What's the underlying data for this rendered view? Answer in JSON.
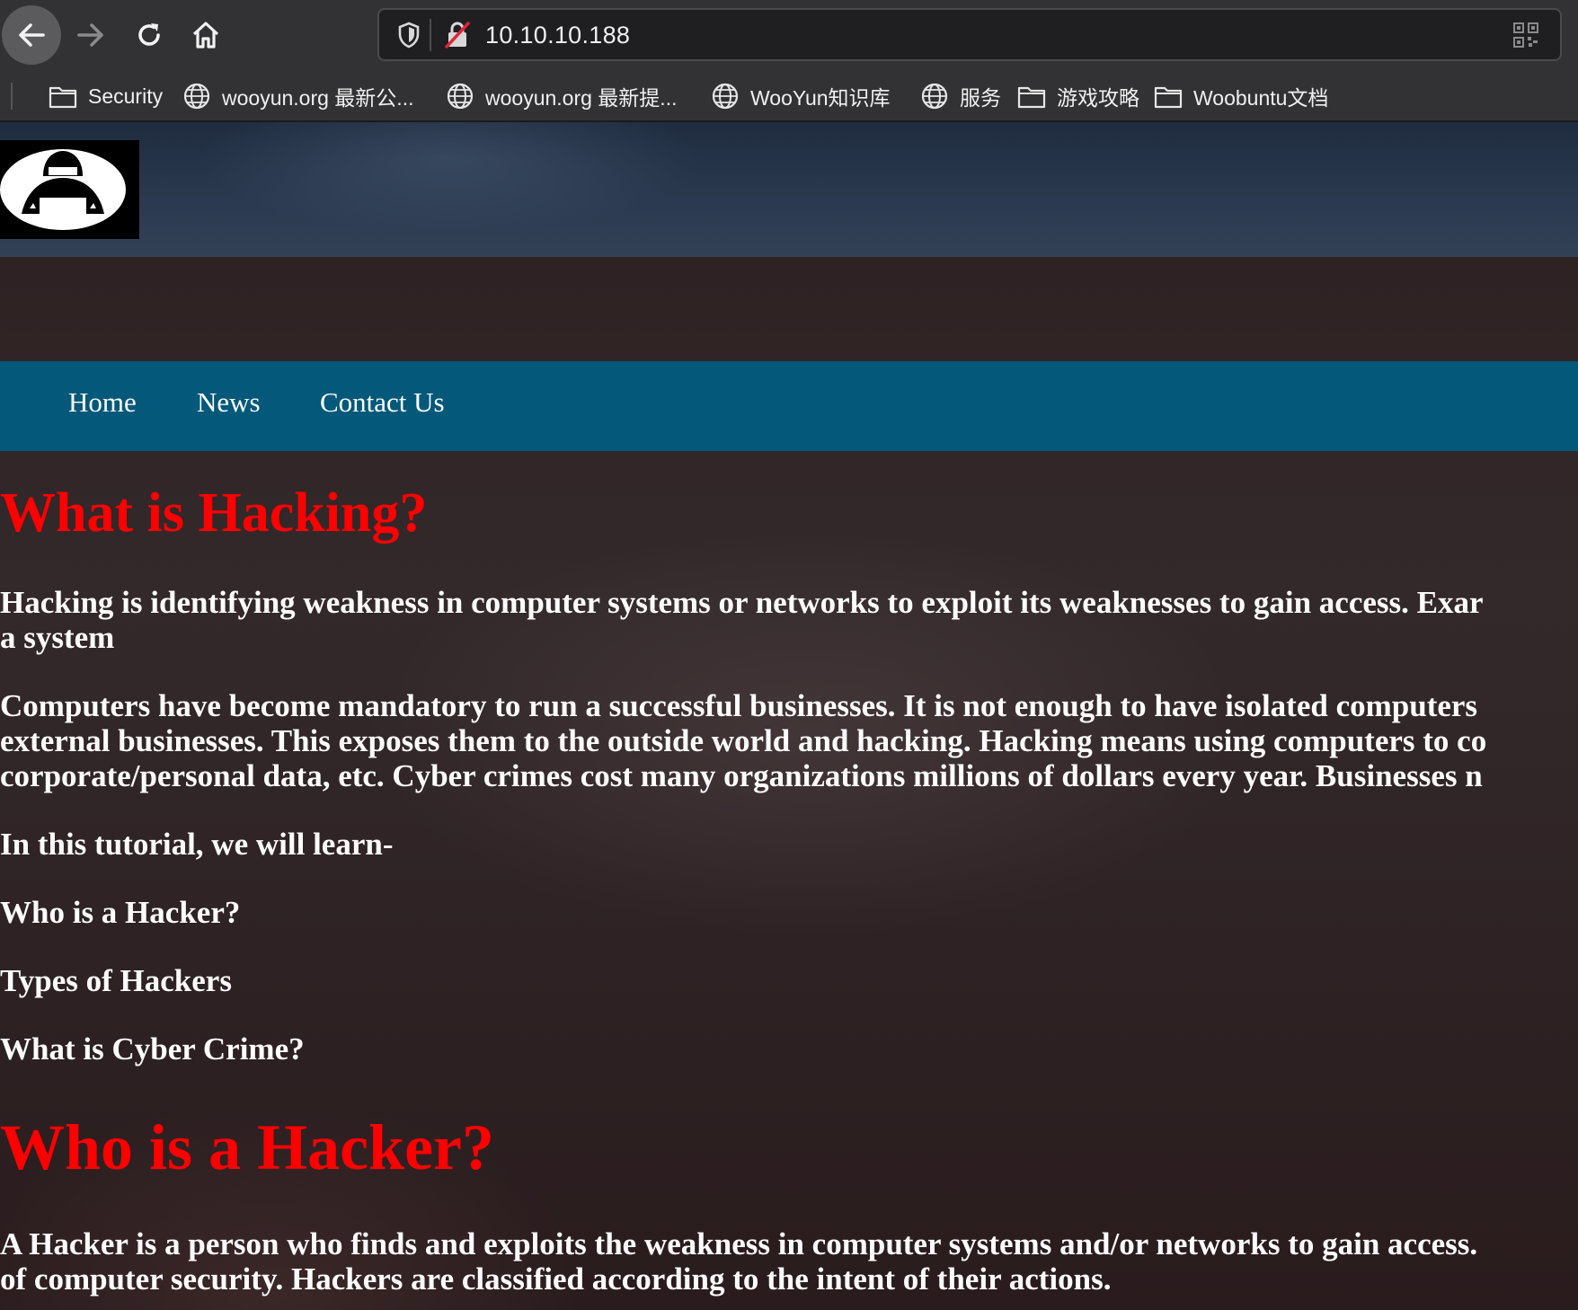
{
  "browser": {
    "url": "10.10.10.188",
    "bookmarks": [
      {
        "label": "Security",
        "icon": "folder-icon"
      },
      {
        "label": "wooyun.org 最新公...",
        "icon": "globe-icon"
      },
      {
        "label": "wooyun.org 最新提...",
        "icon": "globe-icon"
      },
      {
        "label": "WooYun知识库",
        "icon": "globe-icon"
      },
      {
        "label": "服务",
        "icon": "globe-icon"
      },
      {
        "label": "游戏攻略",
        "icon": "folder-icon"
      },
      {
        "label": "Woobuntu文档",
        "icon": "folder-icon"
      }
    ]
  },
  "site": {
    "nav": [
      "Home",
      "News",
      "Contact Us"
    ],
    "heading1": "What is Hacking?",
    "para1": [
      "Hacking is identifying weakness in computer systems or networks to exploit its weaknesses to gain access. Exar",
      "a system"
    ],
    "para2": [
      "Computers have become mandatory to run a successful businesses. It is not enough to have isolated computers",
      "external businesses. This exposes them to the outside world and hacking. Hacking means using computers to co",
      "corporate/personal data, etc. Cyber crimes cost many organizations millions of dollars every year. Businesses n"
    ],
    "intro": "In this tutorial, we will learn-",
    "toc": [
      "Who is a Hacker?",
      "Types of Hackers",
      "What is Cyber Crime?"
    ],
    "heading2": "Who is a Hacker?",
    "para3": [
      "A Hacker is a person who finds and exploits the weakness in computer systems and/or networks to gain access.",
      "of computer security. Hackers are classified according to the intent of their actions."
    ]
  },
  "colors": {
    "heading": "#ff0000",
    "navbar": "#04597a",
    "chrome": "#323234"
  }
}
